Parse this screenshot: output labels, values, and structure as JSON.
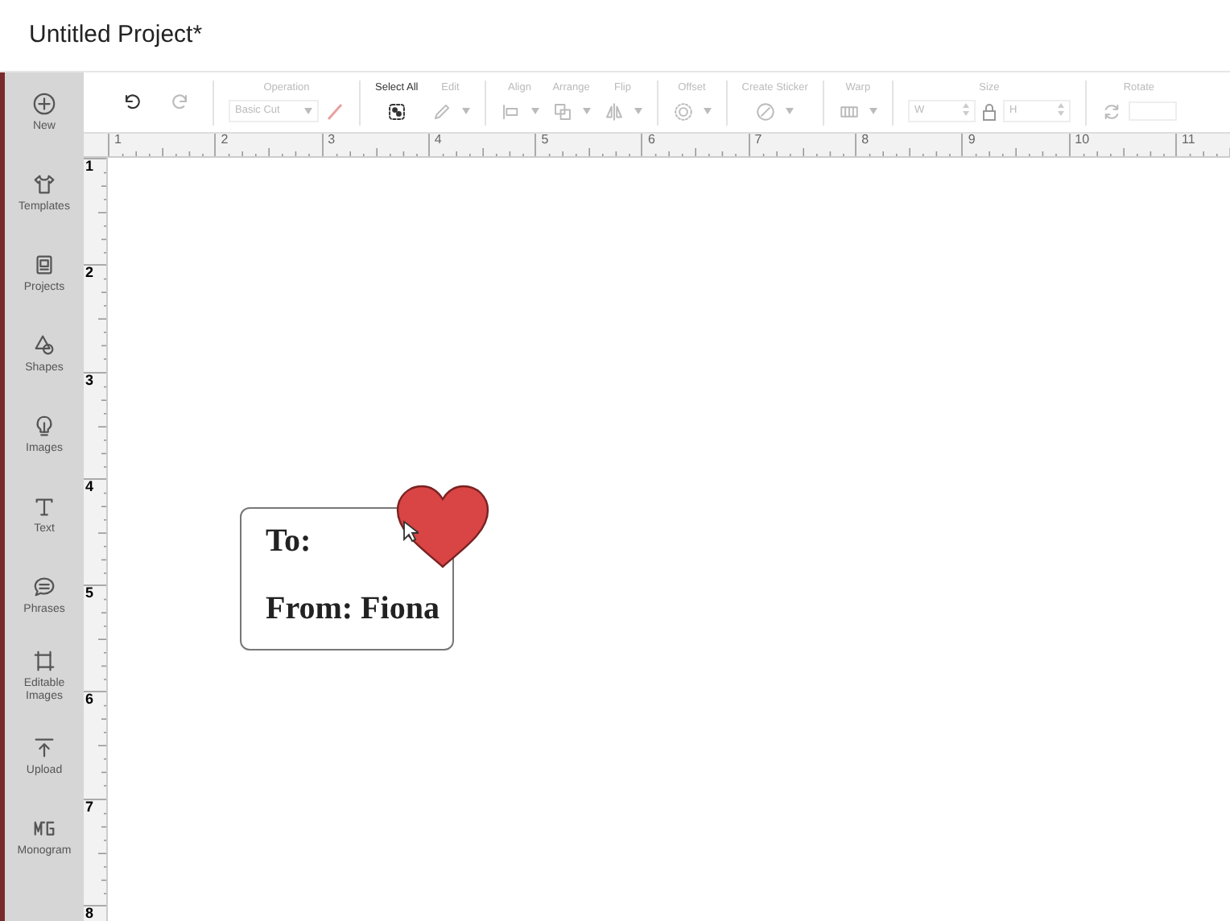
{
  "window": {
    "title": "Untitled Project*"
  },
  "sidebar": {
    "items": [
      {
        "kind": "new",
        "label": "New"
      },
      {
        "kind": "templates",
        "label": "Templates"
      },
      {
        "kind": "projects",
        "label": "Projects"
      },
      {
        "kind": "shapes",
        "label": "Shapes"
      },
      {
        "kind": "images",
        "label": "Images"
      },
      {
        "kind": "text",
        "label": "Text"
      },
      {
        "kind": "phrases",
        "label": "Phrases"
      },
      {
        "kind": "editable",
        "label": "Editable Images"
      },
      {
        "kind": "upload",
        "label": "Upload"
      },
      {
        "kind": "monogram",
        "label": "Monogram"
      }
    ]
  },
  "toolbar": {
    "groups": [
      {
        "tools": [
          {
            "kind": "undo",
            "disabled": false
          },
          {
            "kind": "redo",
            "disabled": true
          }
        ]
      },
      {
        "tools": [
          {
            "kind": "operation",
            "label": "Operation",
            "value": "Basic Cut",
            "disabled": true
          }
        ]
      },
      {
        "tools": [
          {
            "kind": "select-all",
            "label": "Select All",
            "disabled": false,
            "dropdown": false
          },
          {
            "kind": "edit",
            "label": "Edit",
            "disabled": true,
            "dropdown": true
          }
        ]
      },
      {
        "tools": [
          {
            "kind": "align",
            "label": "Align",
            "disabled": true,
            "dropdown": true
          },
          {
            "kind": "arrange",
            "label": "Arrange",
            "disabled": true,
            "dropdown": true
          },
          {
            "kind": "flip",
            "label": "Flip",
            "disabled": true,
            "dropdown": true
          }
        ]
      },
      {
        "tools": [
          {
            "kind": "offset",
            "label": "Offset",
            "disabled": true,
            "dropdown": true
          }
        ]
      },
      {
        "tools": [
          {
            "kind": "sticker",
            "label": "Create Sticker",
            "disabled": true,
            "dropdown": true
          }
        ]
      },
      {
        "tools": [
          {
            "kind": "warp",
            "label": "Warp",
            "disabled": true,
            "dropdown": true
          }
        ]
      },
      {
        "tools": [
          {
            "kind": "size",
            "label": "Size",
            "width_label": "W",
            "height_label": "H",
            "disabled": true
          }
        ]
      },
      {
        "tools": [
          {
            "kind": "rotate",
            "label": "Rotate",
            "disabled": true
          }
        ]
      }
    ]
  },
  "rulers": {
    "horizontal": [
      "1",
      "2",
      "3",
      "4",
      "5",
      "6",
      "7",
      "8",
      "9",
      "10",
      "11"
    ],
    "vertical": [
      "1",
      "2",
      "3",
      "4",
      "5",
      "6",
      "7",
      "8"
    ]
  },
  "canvas": {
    "tag": {
      "lines": [
        "To:",
        "From: Fiona"
      ]
    }
  }
}
